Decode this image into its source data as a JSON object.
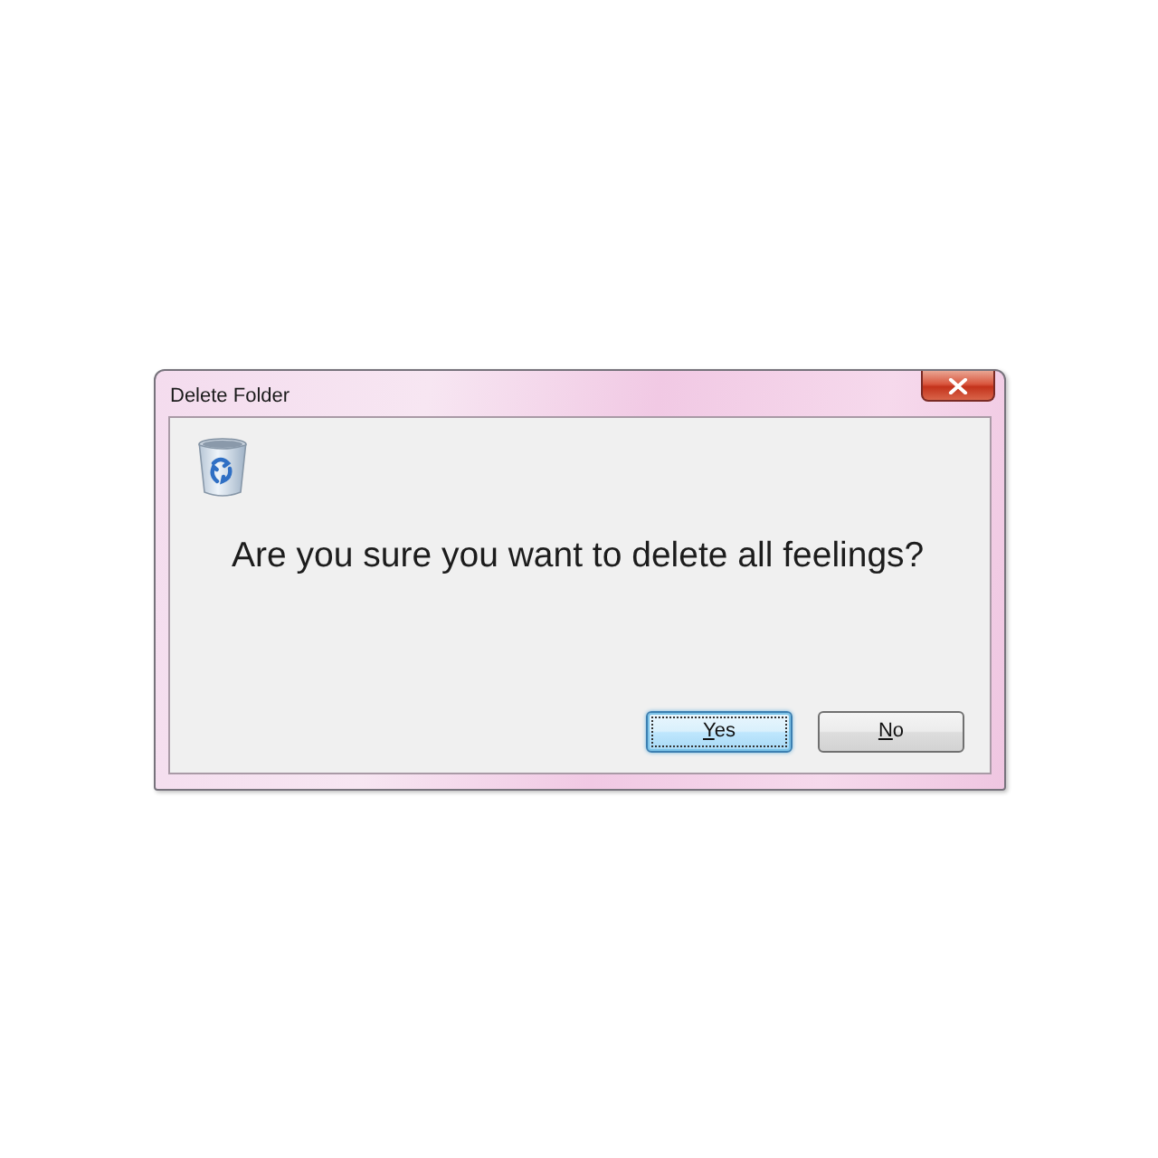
{
  "window": {
    "title": "Delete Folder",
    "message": "Are you sure you want to delete all feelings?",
    "buttons": [
      {
        "label": "Yes",
        "default": true
      },
      {
        "label": "No",
        "default": false
      }
    ]
  }
}
